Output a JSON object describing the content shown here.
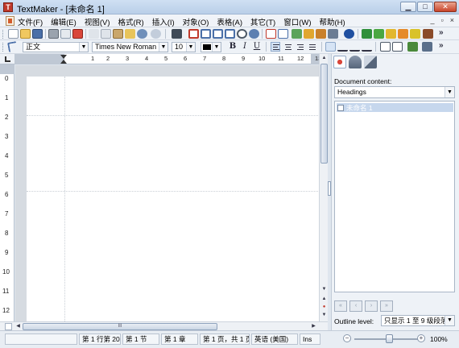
{
  "window": {
    "title": "TextMaker - [未命名 1]",
    "app_icon_letter": "T",
    "buttons": {
      "minimize": "▁",
      "maximize": "□",
      "close": "✕"
    }
  },
  "menu": {
    "items": [
      "文件(F)",
      "编辑(E)",
      "视图(V)",
      "格式(R)",
      "插入(I)",
      "对象(O)",
      "表格(A)",
      "其它(T)",
      "窗口(W)",
      "帮助(H)"
    ],
    "mdi_buttons": [
      "_",
      "▫",
      "×"
    ]
  },
  "toolbar_format": {
    "style_value": "正文",
    "font_value": "Times New Roman",
    "size_value": "10",
    "bold": "B",
    "italic": "I",
    "underline": "U",
    "more": "»"
  },
  "toolbar_standard": {
    "more": "»",
    "icons": [
      "new-document-icon",
      "open-folder-icon",
      "save-icon",
      "print-icon",
      "print-preview-icon",
      "pdf-export-icon",
      "cut-icon",
      "copy-icon",
      "paste-icon",
      "format-painter-icon",
      "undo-icon",
      "redo-icon",
      "find-icon",
      "table-icon",
      "columns-icon",
      "frame-icon",
      "picture-icon",
      "zoom-icon",
      "search-replace-icon",
      "text-frame-icon",
      "field-icon",
      "spell-check-icon",
      "chart-icon",
      "database-icon",
      "document-icon",
      "object-icon",
      "mobile-icon",
      "presentation-icon",
      "planmaker-icon",
      "sync-icon",
      "box-icon"
    ]
  },
  "ruler": {
    "h_numbers": [
      "1",
      "2",
      "3",
      "4",
      "5",
      "6",
      "7",
      "8",
      "9",
      "10",
      "11",
      "12",
      "13"
    ],
    "v_numbers": [
      "0",
      "1",
      "2",
      "3",
      "4",
      "5",
      "6",
      "7",
      "8",
      "9",
      "10",
      "11",
      "12"
    ]
  },
  "sidebar": {
    "document_content_label": "Document content:",
    "content_type_value": "Headings",
    "outline_items": [
      {
        "label": "未命名 1",
        "checked": false
      }
    ],
    "nav_buttons": [
      "«",
      "‹",
      "›",
      "»"
    ],
    "outline_level_label": "Outline level:",
    "outline_level_value": "只显示 1 至 9 级段落"
  },
  "hscroll": {
    "thumb_grip": "III"
  },
  "status": {
    "line": "第 1 行第 20",
    "section": "第 1 节",
    "chapter": "第 1 章",
    "page": "第 1 页，共 1 页",
    "language": "英语 (美国)",
    "mode": "Ins",
    "zoom": "100%"
  },
  "colors": {
    "accent": "#c6d7ed",
    "titlebar": "#b9cfe8",
    "close_button": "#c9442a"
  }
}
